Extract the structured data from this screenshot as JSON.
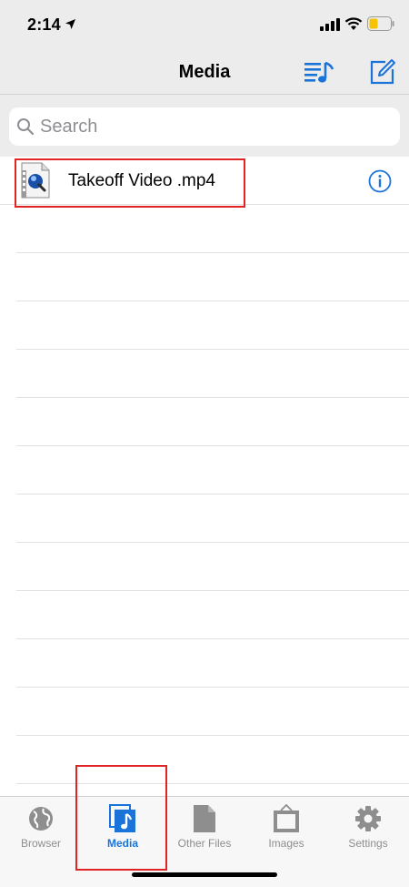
{
  "status_bar": {
    "time": "2:14"
  },
  "nav": {
    "title": "Media"
  },
  "search": {
    "placeholder": "Search",
    "value": ""
  },
  "files": [
    {
      "name": "Takeoff Video .mp4"
    }
  ],
  "tabs": [
    {
      "label": "Browser",
      "icon": "globe-icon",
      "active": false
    },
    {
      "label": "Media",
      "icon": "media-icon",
      "active": true
    },
    {
      "label": "Other Files",
      "icon": "document-icon",
      "active": false
    },
    {
      "label": "Images",
      "icon": "picture-frame-icon",
      "active": false
    },
    {
      "label": "Settings",
      "icon": "gear-icon",
      "active": false
    }
  ],
  "colors": {
    "accent": "#1a73d9",
    "highlight": "#e02424",
    "battery": "#f5c400"
  }
}
